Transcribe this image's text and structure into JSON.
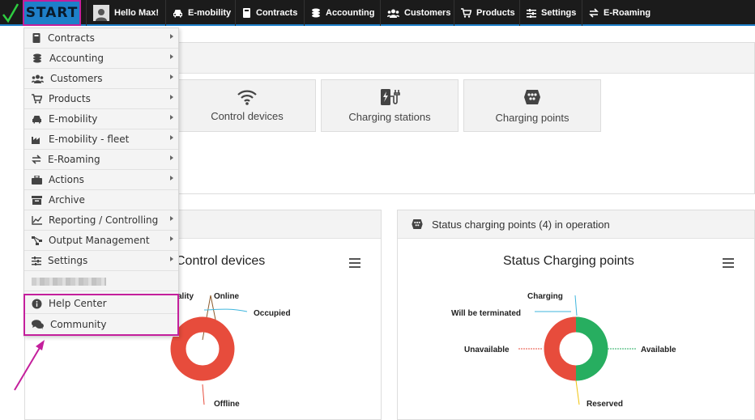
{
  "topbar": {
    "start_label": "START",
    "greeting": "Hello Max!",
    "nav": [
      "E-mobility",
      "Contracts",
      "Accounting",
      "Customers",
      "Products",
      "Settings",
      "E-Roaming"
    ]
  },
  "tiles": [
    "Control devices",
    "Charging stations",
    "Charging points"
  ],
  "chart_left": {
    "title": "Control devices",
    "labels": {
      "ality": "ality",
      "online": "Online",
      "occupied": "Occupied",
      "offline": "Offline"
    }
  },
  "chart_right": {
    "header": "Status charging points (4) in operation",
    "title": "Status Charging points",
    "labels": {
      "charging": "Charging",
      "terminated": "Will be terminated",
      "unavailable": "Unavailable",
      "available": "Available",
      "reserved": "Reserved"
    }
  },
  "menu": {
    "items": [
      {
        "label": "Contracts",
        "icon": "book-icon",
        "arrow": true
      },
      {
        "label": "Accounting",
        "icon": "coins-icon",
        "arrow": true
      },
      {
        "label": "Customers",
        "icon": "users-icon",
        "arrow": true
      },
      {
        "label": "Products",
        "icon": "cart-icon",
        "arrow": true
      },
      {
        "label": "E-mobility",
        "icon": "car-icon",
        "arrow": true
      },
      {
        "label": "E-mobility - fleet",
        "icon": "industry-icon",
        "arrow": true
      },
      {
        "label": "E-Roaming",
        "icon": "exchange-icon",
        "arrow": true
      },
      {
        "label": "Actions",
        "icon": "briefcase-icon",
        "arrow": true
      },
      {
        "label": "Archive",
        "icon": "archive-icon",
        "arrow": false
      },
      {
        "label": "Reporting / Controlling",
        "icon": "line-chart-icon",
        "arrow": true
      },
      {
        "label": "Output Management",
        "icon": "sitemap-icon",
        "arrow": true
      },
      {
        "label": "Settings",
        "icon": "sliders-icon",
        "arrow": true
      }
    ],
    "help_center": "Help Center",
    "community": "Community"
  },
  "colors": {
    "accent": "#1e7fc9",
    "highlight": "#c41f9c",
    "green": "#27ae60",
    "red": "#e74c3c",
    "topbar": "#1b1b1b"
  }
}
